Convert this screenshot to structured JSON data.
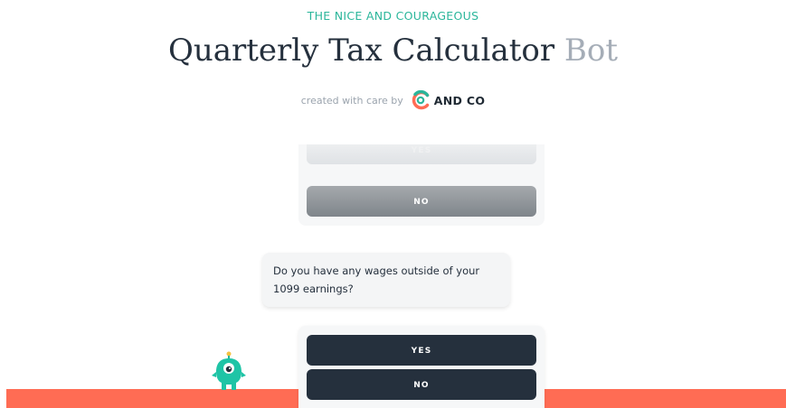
{
  "header": {
    "eyebrow": "THE NICE AND COURAGEOUS",
    "title_main": "Quarterly Tax Calculator",
    "title_accent": "Bot",
    "credit_text": "created with care by",
    "brand_name": "AND CO"
  },
  "chat": {
    "previous_answer": {
      "yes_label": "YES",
      "no_label": "NO"
    },
    "question": "Do you have any wages outside of your 1099 earnings?",
    "current_answer": {
      "yes_label": "YES",
      "no_label": "NO"
    }
  },
  "colors": {
    "accent_teal": "#2bb69b",
    "dark_navy": "#25303d",
    "footer_coral": "#ff6c54"
  },
  "icons": {
    "brand_logo": "andco-ring-logo",
    "mascot": "teal-monster-mascot"
  }
}
